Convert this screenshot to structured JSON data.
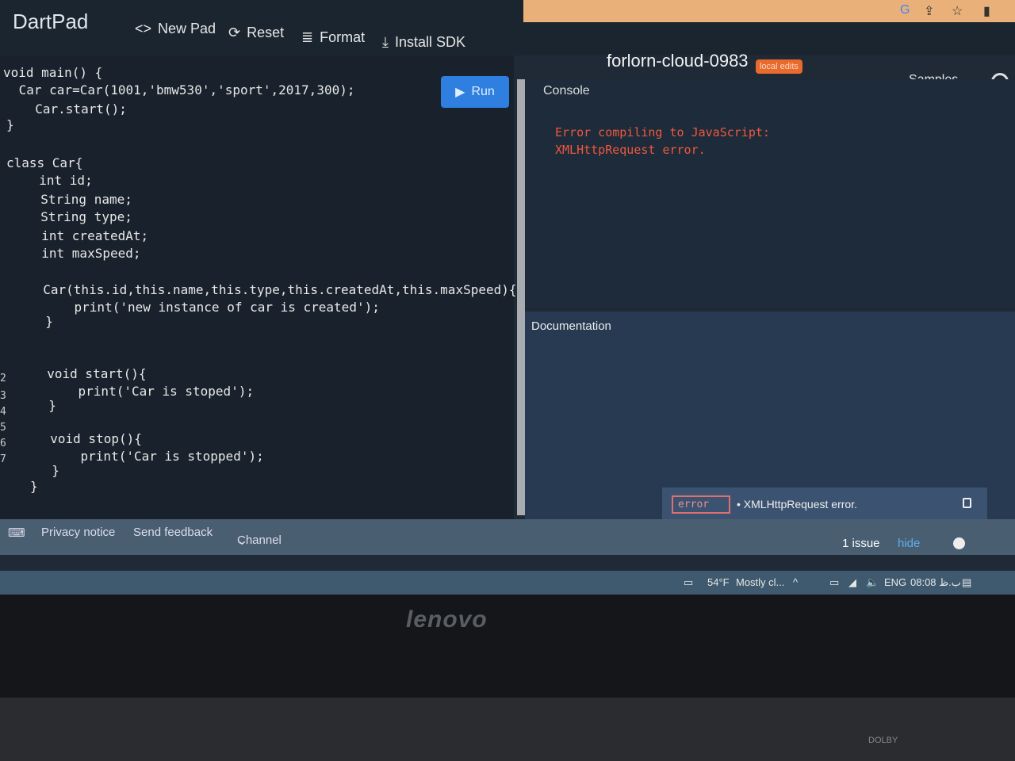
{
  "browser": {
    "icons": [
      "google-icon",
      "share-icon",
      "star-icon",
      "extension-icon"
    ]
  },
  "app": {
    "name": "DartPad",
    "title": "forlorn-cloud-0983",
    "badge": "local edits",
    "samples": "Samples"
  },
  "toolbar": {
    "new_pad": "New Pad",
    "reset": "Reset",
    "format": "Format",
    "install_sdk": "Install SDK",
    "run": "Run"
  },
  "editor": {
    "lines": [
      "void main() {",
      " Car car=Car(1001,'bmw530','sport',2017,300);",
      "  Car.start();",
      "}",
      "",
      "class Car{",
      "  int id;",
      "  String name;",
      "  String type;",
      "  int createdAt;",
      "  int maxSpeed;",
      "",
      "  Car(this.id,this.name,this.type,this.createdAt,this.maxSpeed){",
      "    print('new instance of car is created');",
      "  }",
      "",
      "",
      "  void start(){",
      "    print('Car is stoped');",
      "  }",
      "",
      "  void stop(){",
      "    print('Car is stopped');",
      "  }",
      "}"
    ],
    "gutter": [
      "2",
      "3",
      "4",
      "5",
      "6",
      "7"
    ]
  },
  "console": {
    "header": "Console",
    "error_line1": "Error compiling to JavaScript:",
    "error_line2": "XMLHttpRequest error."
  },
  "docs": {
    "header": "Documentation"
  },
  "issues": {
    "tag": "error",
    "message": "• XMLHttpRequest error.",
    "count": "1 issue",
    "hide": "hide"
  },
  "footer": {
    "privacy": "Privacy notice",
    "feedback": "Send feedback",
    "channel": "Channel"
  },
  "taskbar": {
    "weather": "54°F",
    "condition": "Mostly cl...",
    "lang": "ENG",
    "time": "08:08 ب.ظ"
  },
  "laptop": {
    "brand": "lenovo",
    "audio": "DOLBY"
  },
  "colors": {
    "accent": "#2f7fe0",
    "error": "#f0583e",
    "badge": "#e86a2d"
  }
}
